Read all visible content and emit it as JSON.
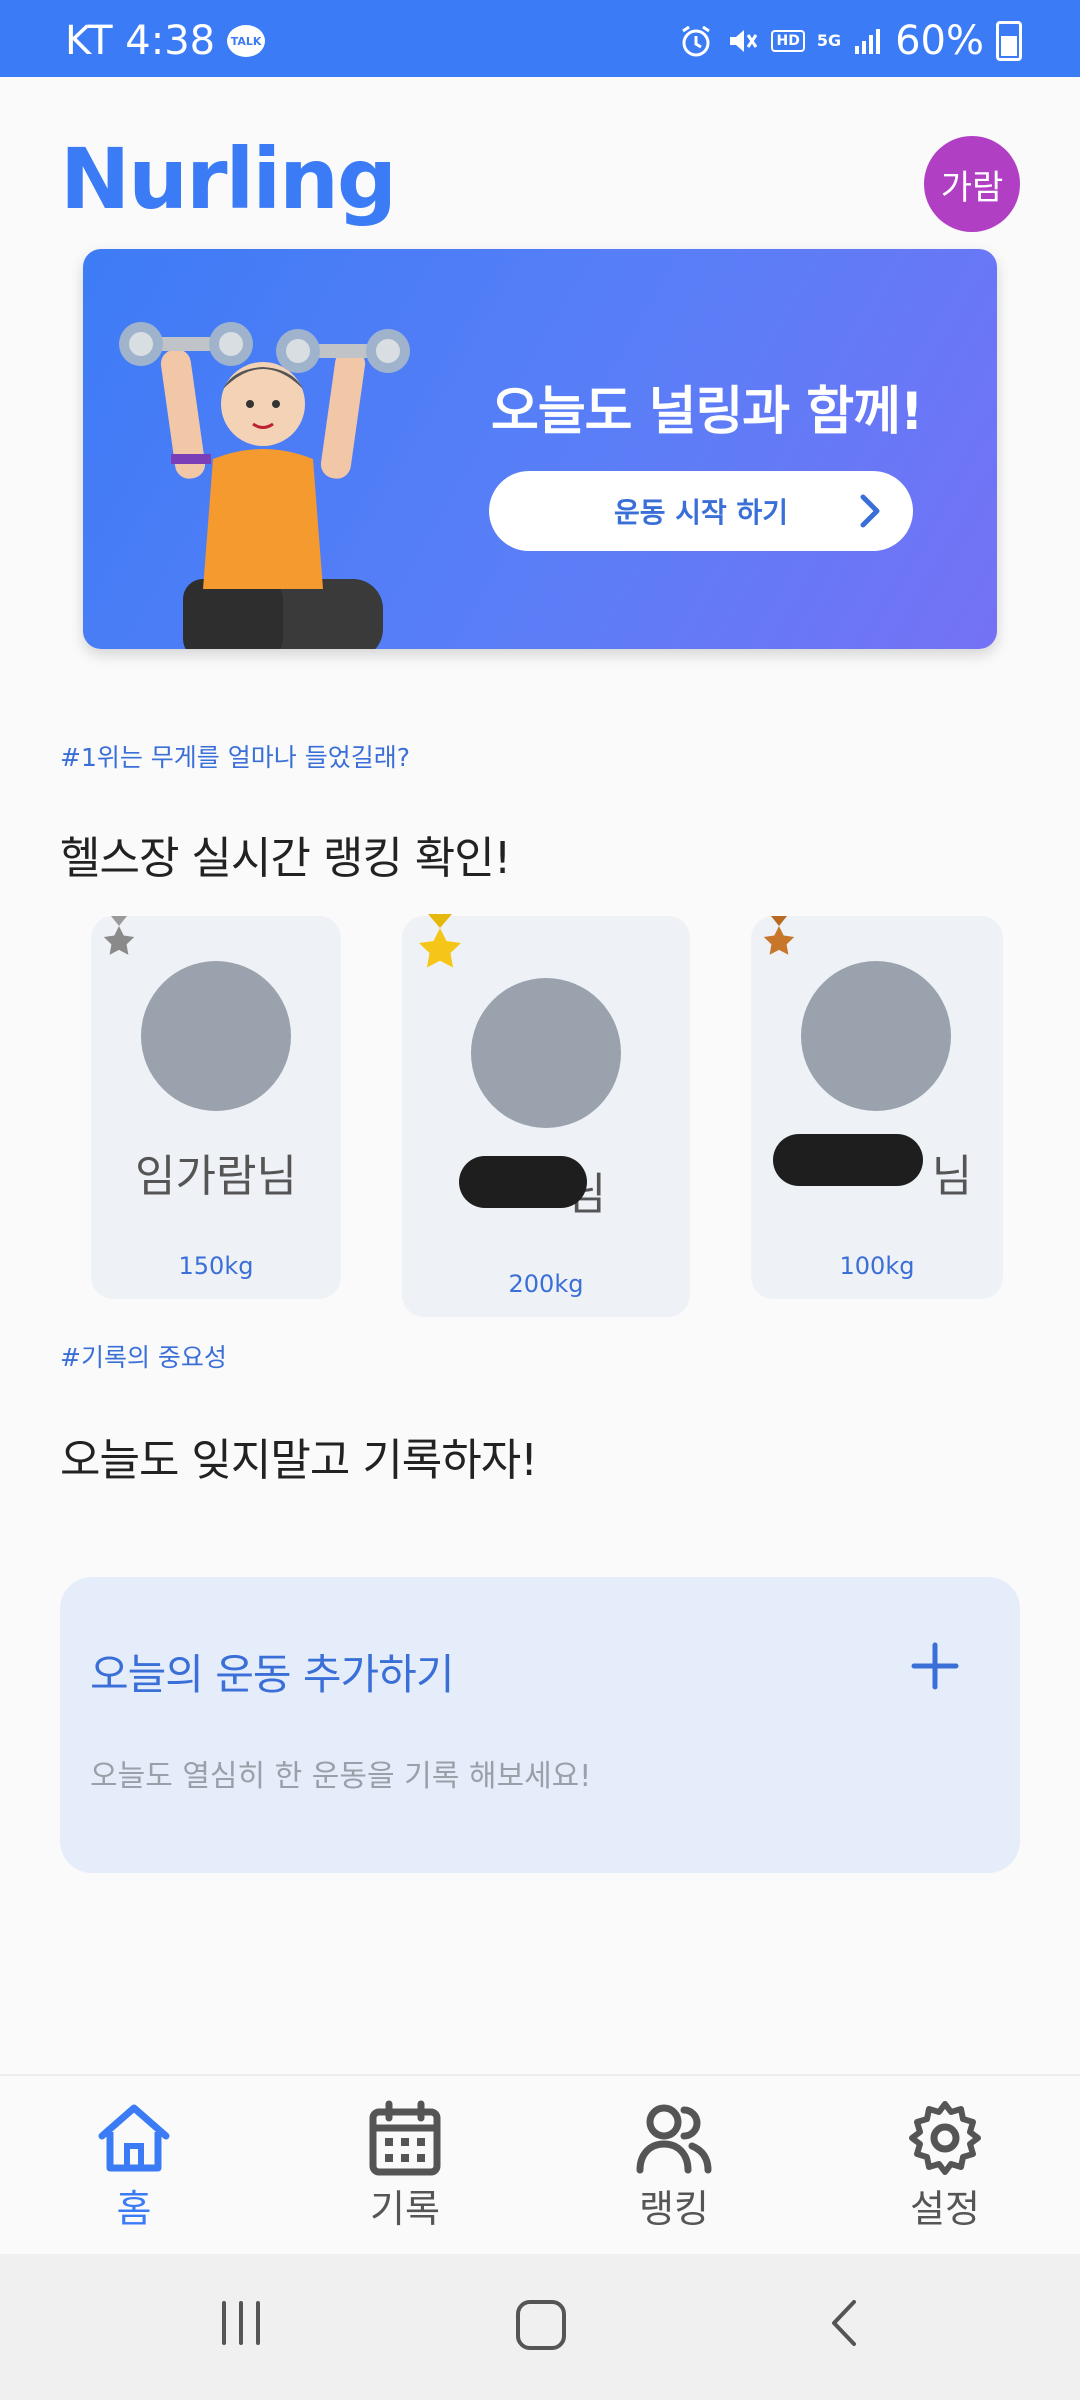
{
  "status_bar": {
    "carrier_time": "KT 4:38",
    "talk_badge": "TALK",
    "hd_badge": "HD",
    "network_badge": "5G",
    "battery_percent": "60%",
    "icons": [
      "alarm-icon",
      "mute-icon",
      "signal-icon",
      "battery-icon"
    ]
  },
  "header": {
    "title": "Nurling",
    "avatar_label": "가람"
  },
  "banner": {
    "headline": "오늘도 널링과 함께!",
    "button_label": "운동 시작 하기"
  },
  "ranking": {
    "hashtag": "#1위는 무게를 얼마나 들었길래?",
    "title": "헬스장 실시간 랭킹 확인!",
    "cards": [
      {
        "rank": 2,
        "name": "임가람님",
        "weight": "150kg",
        "medal": "silver"
      },
      {
        "rank": 1,
        "name": "님",
        "weight": "200kg",
        "medal": "gold"
      },
      {
        "rank": 3,
        "name": "님",
        "weight": "100kg",
        "medal": "bronze"
      }
    ]
  },
  "record": {
    "hashtag": "#기록의 중요성",
    "title": "오늘도 잊지말고 기록하자!",
    "add_title": "오늘의 운동 추가하기",
    "add_subtitle": "오늘도 열심히 한 운동을 기록 해보세요!"
  },
  "bottom_nav": [
    {
      "label": "홈",
      "icon": "home-icon",
      "active": true
    },
    {
      "label": "기록",
      "icon": "calendar-icon",
      "active": false
    },
    {
      "label": "랭킹",
      "icon": "users-icon",
      "active": false
    },
    {
      "label": "설정",
      "icon": "gear-icon",
      "active": false
    }
  ],
  "colors": {
    "primary": "#3b7bf5",
    "avatar": "#b13fc4",
    "gold": "#f5c518",
    "silver": "#8a8a8a",
    "bronze": "#c8762a"
  }
}
